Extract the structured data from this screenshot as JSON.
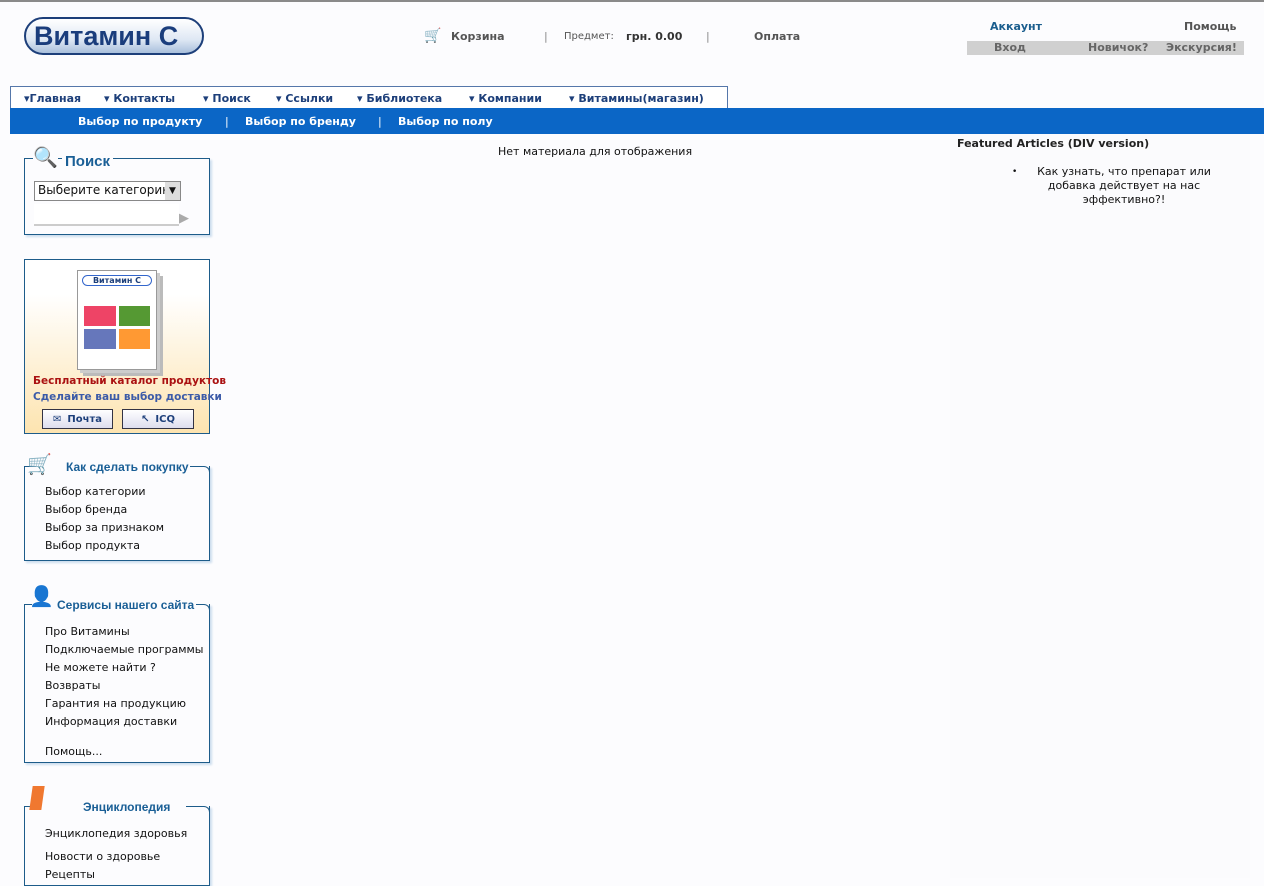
{
  "header": {
    "logo": "Витамин C",
    "cart": "Корзина",
    "item_label": "Предмет:",
    "item_value": "грн. 0.00",
    "payment": "Оплата",
    "account": "Аккаунт",
    "help": "Помощь",
    "login": "Вход",
    "newbie": "Новичок?",
    "tour": "Экскурсия!"
  },
  "nav": [
    "Главная",
    "Контакты",
    "Поиск",
    "Ссылки",
    "Библиотека",
    "Компании",
    "Витамины(магазин)"
  ],
  "subnav": [
    "Выбор по продукту",
    "Выбор по бренду",
    "Выбор по полу"
  ],
  "search": {
    "title": "Поиск",
    "category": "Выберите категорию"
  },
  "catalog": {
    "line1": "Бесплатный каталог продуктов",
    "line2": "Сделайте ваш выбор доставки",
    "mail": "Почта",
    "icq": "ICQ"
  },
  "howto": {
    "title": "Как сделать покупку",
    "items": [
      "Выбор категории",
      "Выбор бренда",
      "Выбор за признаком",
      "Выбор продукта"
    ]
  },
  "services": {
    "title": "Сервисы нашего сайта",
    "items": [
      "Про Витамины",
      "Подключаемые программы",
      "Не можете найти ?",
      "Возвраты",
      "Гарантия на продукцию",
      "Информация доставки",
      "Помощь..."
    ]
  },
  "encyclopedia": {
    "title": "Энциклопедия",
    "items": [
      "Энциклопедия здоровья",
      "Новости о здоровье",
      "Рецепты"
    ]
  },
  "main": {
    "empty": "Нет материала для отображения"
  },
  "featured": {
    "title": "Featured Articles (DIV version)",
    "items": [
      "Как узнать, что препарат или добавка действует на нас эффективно?!"
    ]
  }
}
